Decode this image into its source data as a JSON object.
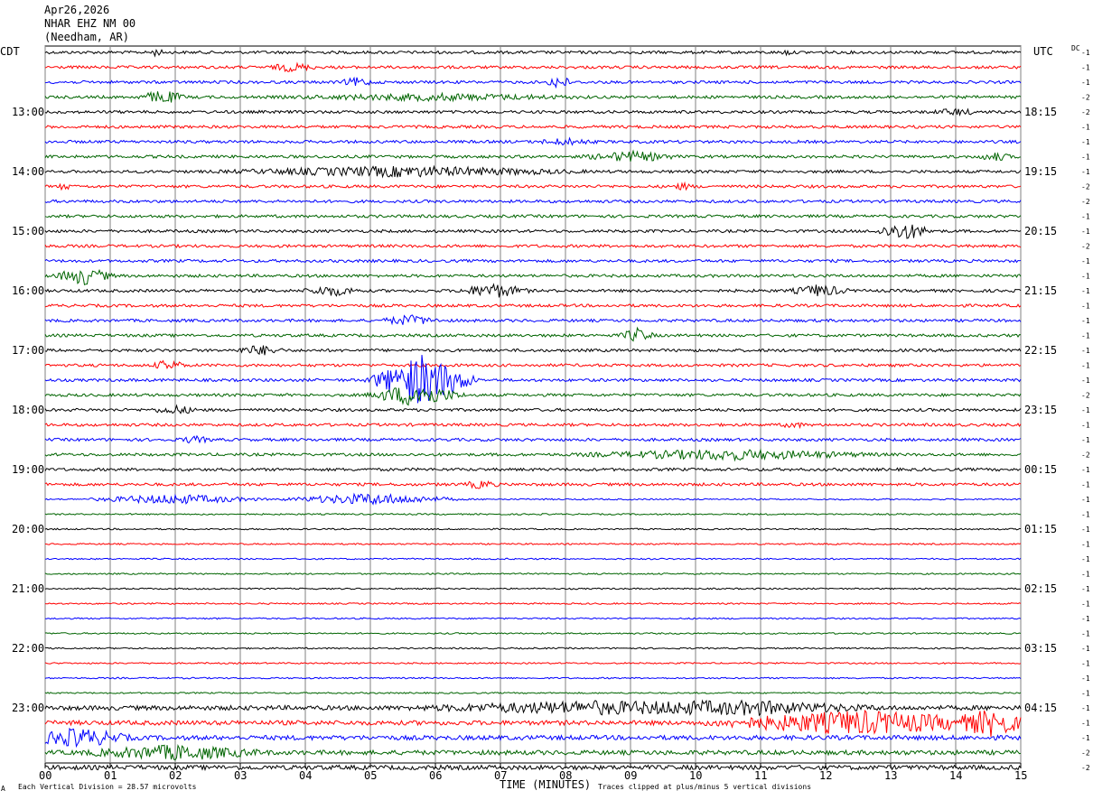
{
  "header": {
    "date": "Apr26,2026",
    "station": "NHAR EHZ NM 00",
    "location": "(Needham, AR)"
  },
  "left_zone": "CDT",
  "right_zone": "UTC",
  "dc_label": "DC",
  "footer": {
    "scale_text": "Each Vertical Division =   28.57 microvolts",
    "xaxis_title": "TIME (MINUTES)",
    "clip_text": "Traces clipped at plus/minus 5 vertical divisions"
  },
  "colors": {
    "black": "#000000",
    "red": "#ff0000",
    "blue": "#0000ff",
    "green": "#006400",
    "grid": "#808080"
  },
  "chart_data": {
    "type": "line",
    "title": "NHAR EHZ NM 00 (Needham, AR) Apr26,2026",
    "xlabel": "TIME (MINUTES)",
    "x_ticks": [
      "00",
      "01",
      "02",
      "03",
      "04",
      "05",
      "06",
      "07",
      "08",
      "09",
      "10",
      "11",
      "12",
      "13",
      "14",
      "15"
    ],
    "xlim": [
      0,
      15
    ],
    "left_hour_labels": [
      "13:00",
      "14:00",
      "15:00",
      "16:00",
      "17:00",
      "18:00",
      "19:00",
      "20:00",
      "21:00",
      "22:00",
      "23:00"
    ],
    "right_hour_labels": [
      "18:15",
      "19:15",
      "20:15",
      "21:15",
      "22:15",
      "23:15",
      "00:15",
      "01:15",
      "02:15",
      "03:15",
      "04:15"
    ],
    "trace_colors": [
      "black",
      "red",
      "blue",
      "green"
    ],
    "dc_offsets": [
      -1,
      -1,
      -1,
      -2,
      -2,
      -1,
      -1,
      -1,
      -1,
      -2,
      -2,
      -1,
      -1,
      -2,
      -1,
      -1,
      -1,
      -1,
      -1,
      -1,
      -1,
      -1,
      -1,
      -2,
      -1,
      -1,
      -1,
      -2,
      -1,
      -1,
      -1,
      -1,
      -1,
      -1,
      -1,
      -1,
      -1,
      -1,
      -1,
      -1,
      -1,
      -1,
      -1,
      -1,
      -1,
      -1,
      -1,
      -2,
      -2
    ]
  }
}
